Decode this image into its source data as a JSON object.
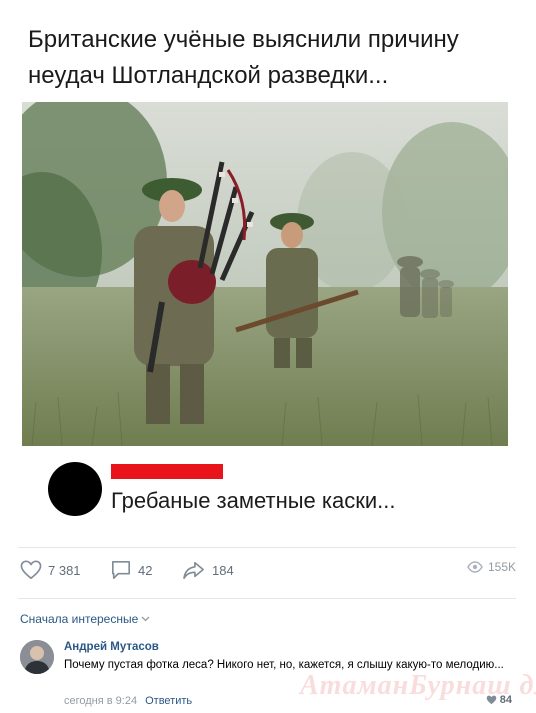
{
  "post": {
    "title": "Британские учёные выяснили причину неудач Шотландской разведки..."
  },
  "meme": {
    "caption": "Гребаные заметные каски..."
  },
  "actions": {
    "likes": "7 381",
    "comments": "42",
    "shares": "184",
    "views": "155K"
  },
  "comments_section": {
    "sort_label": "Сначала интересные"
  },
  "comment": {
    "author": "Андрей Мутасов",
    "text": "Почему пустая фотка леса? Никого нет, но, кажется, я слышу какую-то мелодию...",
    "time": "сегодня в 9:24",
    "reply_label": "Ответить",
    "likes": "84"
  },
  "watermark": "АтаманБурнаш для ЯП",
  "colors": {
    "link": "#2a5885",
    "meta": "#939ba3",
    "red_bar": "#e8141a",
    "divider": "#e4e6ea"
  }
}
